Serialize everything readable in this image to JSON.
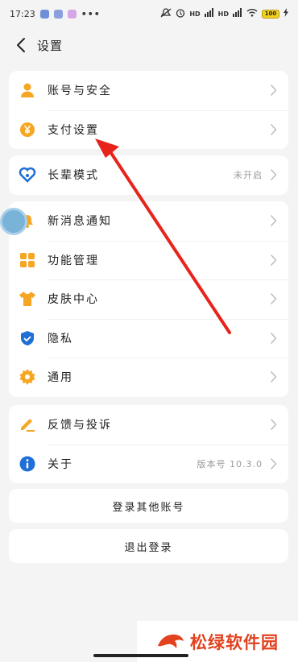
{
  "status_bar": {
    "time": "17:23",
    "dots": "•••",
    "hd1": "HD",
    "hd2": "HD",
    "battery": "100"
  },
  "header": {
    "title": "设置"
  },
  "group1": [
    {
      "label": "账号与安全",
      "icon": "person-icon",
      "color": "#f5a623"
    },
    {
      "label": "支付设置",
      "icon": "yuan-coin-icon",
      "color": "#f5a623"
    }
  ],
  "group2": [
    {
      "label": "长辈模式",
      "value": "未开启",
      "icon": "heart-icon",
      "color": "#1f6fd6"
    }
  ],
  "group3": [
    {
      "label": "新消息通知",
      "icon": "bell-icon",
      "color": "#f5a623"
    },
    {
      "label": "功能管理",
      "icon": "grid-icon",
      "color": "#f5a623"
    },
    {
      "label": "皮肤中心",
      "icon": "tshirt-icon",
      "color": "#f5a623"
    },
    {
      "label": "隐私",
      "icon": "shield-check-icon",
      "color": "#1f6fd6"
    },
    {
      "label": "通用",
      "icon": "gear-icon",
      "color": "#f5a623"
    }
  ],
  "group4": [
    {
      "label": "反馈与投诉",
      "icon": "pencil-icon",
      "color": "#f5a623"
    },
    {
      "label": "关于",
      "value": "版本号 10.3.0",
      "icon": "info-icon",
      "color": "#1f6fd6"
    }
  ],
  "buttons": {
    "switch_account": "登录其他账号",
    "logout": "退出登录"
  },
  "watermark": {
    "text": "松绿软件园"
  },
  "colors": {
    "accent": "#f5a623",
    "blue": "#1f6fd6",
    "annotation_arrow": "#e8231c"
  }
}
